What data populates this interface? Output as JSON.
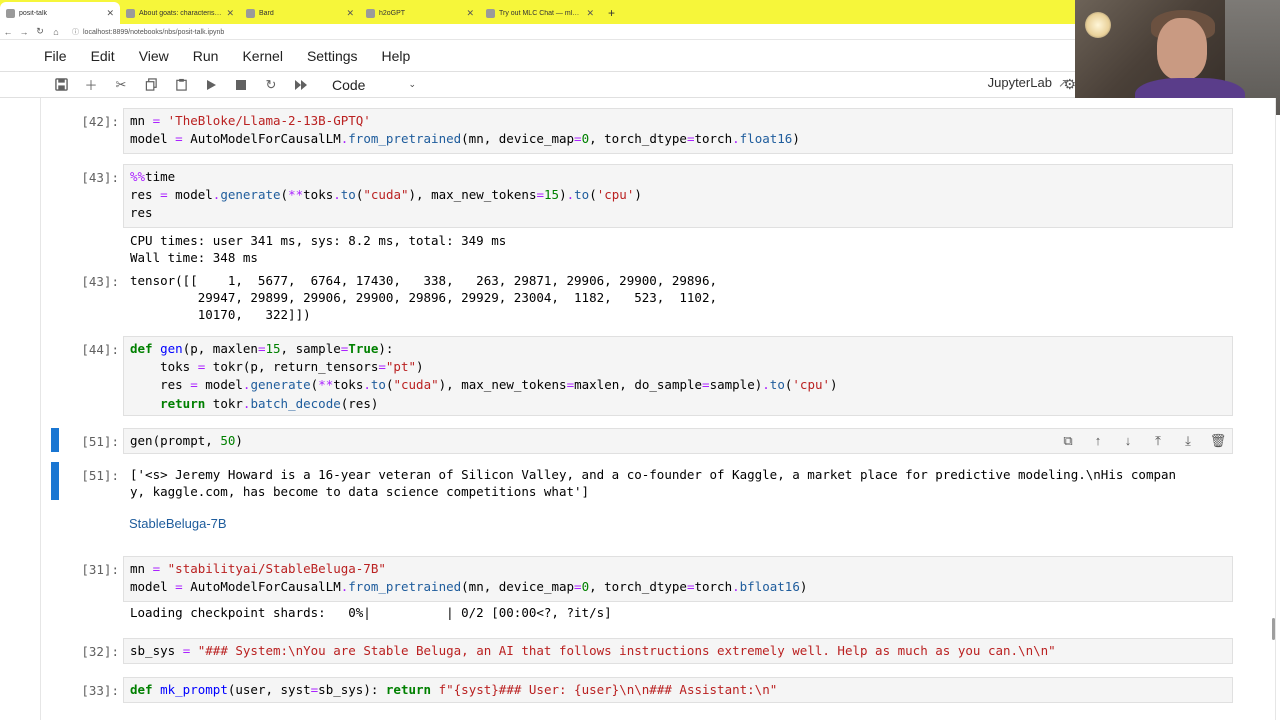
{
  "browser": {
    "tabs": [
      {
        "title": "posit-talk",
        "active": true
      },
      {
        "title": "About goats: characteristics &...",
        "active": false
      },
      {
        "title": "Bard",
        "active": false
      },
      {
        "title": "h2oGPT",
        "active": false
      },
      {
        "title": "Try out MLC Chat — mlc-llm 0...",
        "active": false
      }
    ],
    "new_tab": "+",
    "url": "localhost:8899/notebooks/nbs/posit-talk.ipynb"
  },
  "menubar": {
    "items": [
      "File",
      "Edit",
      "View",
      "Run",
      "Kernel",
      "Settings",
      "Help"
    ]
  },
  "toolbar": {
    "cell_type": "Code",
    "app_link": "JupyterLab"
  },
  "cells": {
    "c42": {
      "prompt": "[42]:",
      "lines": [
        "mn = 'TheBloke/Llama-2-13B-GPTQ'",
        "model = AutoModelForCausalLM.from_pretrained(mn, device_map=0, torch_dtype=torch.float16)"
      ]
    },
    "c43": {
      "prompt": "[43]:",
      "lines": [
        "%%time",
        "res = model.generate(**toks.to(\"cuda\"), max_new_tokens=15).to('cpu')",
        "res"
      ],
      "stdout": [
        "CPU times: user 341 ms, sys: 8.2 ms, total: 349 ms",
        "Wall time: 348 ms"
      ],
      "out_prompt": "[43]:",
      "output": [
        "tensor([[    1,  5677,  6764, 17430,   338,   263, 29871, 29906, 29900, 29896,",
        "         29947, 29899, 29906, 29900, 29896, 29929, 23004,  1182,   523,  1102,",
        "         10170,   322]])"
      ]
    },
    "c44": {
      "prompt": "[44]:",
      "lines": [
        "def gen(p, maxlen=15, sample=True):",
        "    toks = tokr(p, return_tensors=\"pt\")",
        "    res = model.generate(**toks.to(\"cuda\"), max_new_tokens=maxlen, do_sample=sample).to('cpu')",
        "    return tokr.batch_decode(res)"
      ]
    },
    "c51": {
      "prompt": "[51]:",
      "lines": [
        "gen(prompt, 50)"
      ],
      "out_prompt": "[51]:",
      "output": [
        "['<s> Jeremy Howard is a 16-year veteran of Silicon Valley, and a co-founder of Kaggle, a market place for predictive modeling.\\nHis compan",
        "y, kaggle.com, has become to data science competitions what']"
      ]
    },
    "md": {
      "text": "StableBeluga-7B"
    },
    "c31": {
      "prompt": "[31]:",
      "lines": [
        "mn = \"stabilityai/StableBeluga-7B\"",
        "model = AutoModelForCausalLM.from_pretrained(mn, device_map=0, torch_dtype=torch.bfloat16)"
      ],
      "stderr": [
        "Loading checkpoint shards:   0%|          | 0/2 [00:00<?, ?it/s]"
      ]
    },
    "c32": {
      "prompt": "[32]:",
      "lines": [
        "sb_sys = \"### System:\\nYou are Stable Beluga, an AI that follows instructions extremely well. Help as much as you can.\\n\\n\""
      ]
    },
    "c33": {
      "prompt": "[33]:",
      "lines": [
        "def mk_prompt(user, syst=sb_sys): return f\"{syst}### User: {user}\\n\\n### Assistant:\\n\""
      ]
    }
  },
  "colors": {
    "accent": "#1976d2",
    "tabstrip": "#f6f63a"
  }
}
